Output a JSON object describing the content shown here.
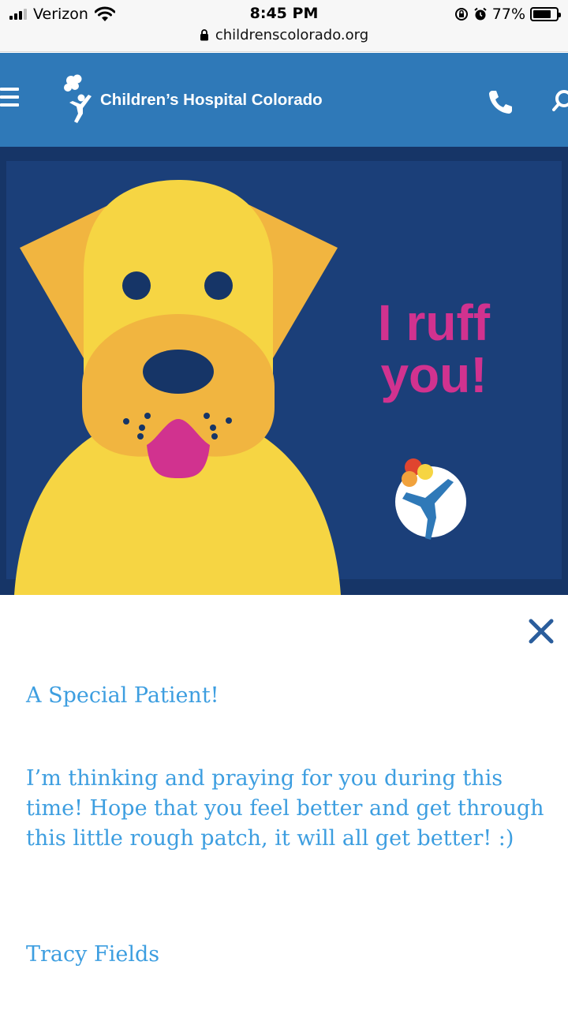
{
  "status_bar": {
    "carrier": "Verizon",
    "time": "8:45 PM",
    "battery_level": "77%",
    "battery_fraction": 0.77,
    "url": "childrenscolorado.org",
    "icons": [
      "signal-icon",
      "wifi-icon",
      "lock-icon",
      "rotation-lock-icon",
      "alarm-icon",
      "battery-icon"
    ]
  },
  "header": {
    "brand": "Children’s Hospital Colorado",
    "background_color": "#2f79b8",
    "icons": [
      "menu-icon",
      "logo-icon",
      "phone-icon",
      "search-icon"
    ]
  },
  "card": {
    "title_line1": "I ruff",
    "title_line2": "you!",
    "background_color": "#163567",
    "accent_color": "#d1328f",
    "dog_color": "#f6d543"
  },
  "message": {
    "title": "A Special Patient!",
    "body": "I’m thinking and praying for you during this time! Hope that you feel better and get through this little rough patch, it will all get better! :)",
    "signature": "Tracy Fields",
    "text_color": "#3d9ee0"
  }
}
